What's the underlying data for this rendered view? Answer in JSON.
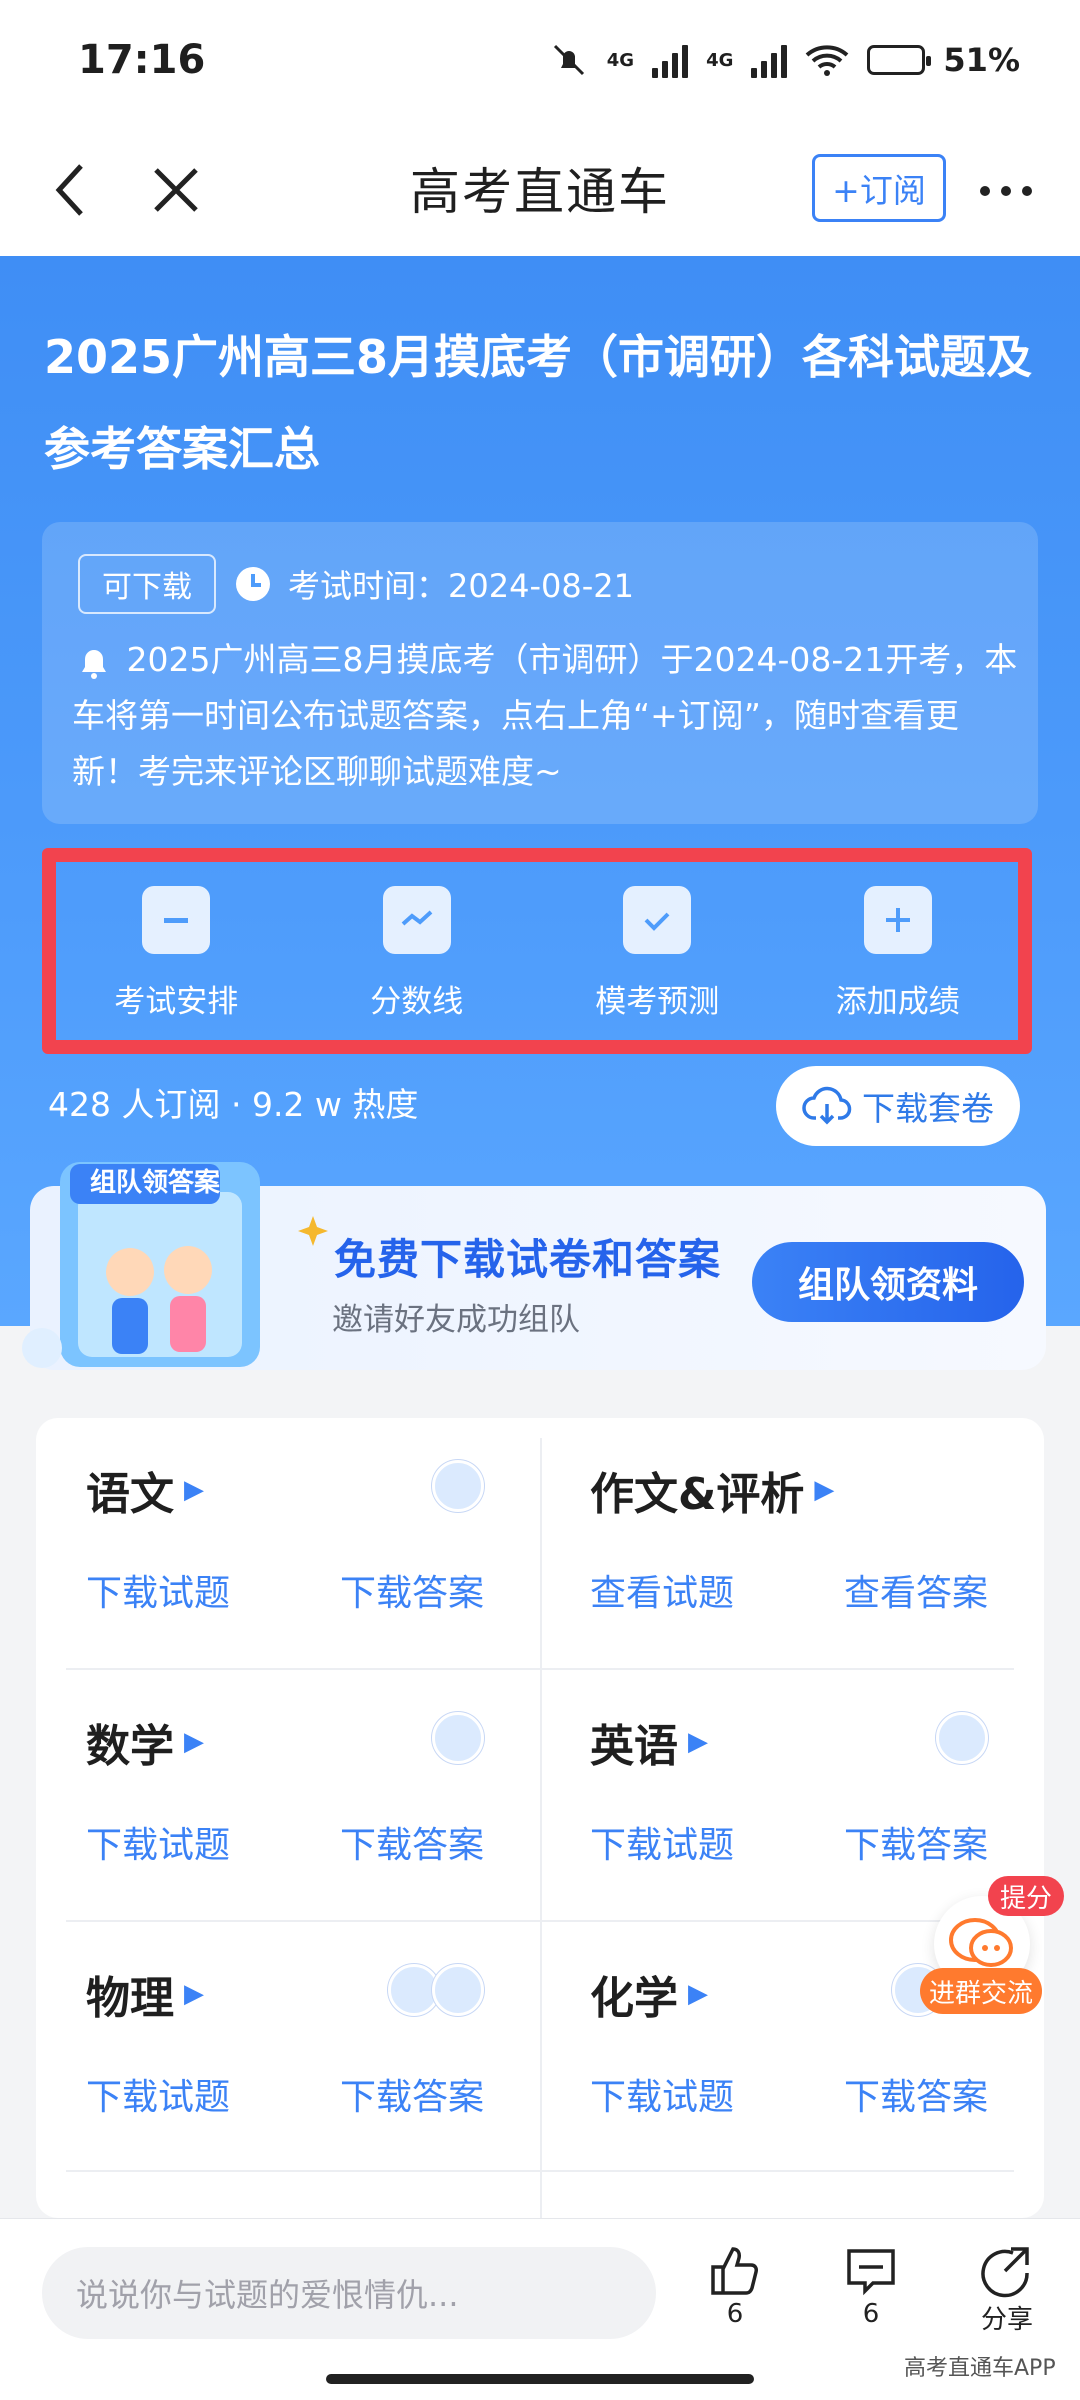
{
  "status": {
    "time": "17:16",
    "net1": "4G",
    "net2": "4G",
    "battery": "51%",
    "battery_level": 0.51
  },
  "nav": {
    "title": "高考直通车",
    "subscribe": "+订阅"
  },
  "hero": {
    "title": "2025广州高三8月摸底考（市调研）各科试题及参考答案汇总",
    "tag": "可下载",
    "exam_time_label": "考试时间：2024-08-21",
    "notice": "2025广州高三8月摸底考（市调研）于2024-08-21开考，本车将第一时间公布试题答案，点右上角“+订阅”，随时查看更新！考完来评论区聊聊试题难度~",
    "actions": [
      {
        "label": "考试安排",
        "icon": "minus-calendar-icon"
      },
      {
        "label": "分数线",
        "icon": "line-chart-icon"
      },
      {
        "label": "模考预测",
        "icon": "check-clipboard-icon"
      },
      {
        "label": "添加成绩",
        "icon": "plus-icon"
      }
    ],
    "stats": "428 人订阅 · 9.2 w 热度",
    "download_set": "下载套卷"
  },
  "banner": {
    "illustration_text": "组队领答案",
    "title": "免费下载试卷和答案",
    "subtitle": "邀请好友成功组队",
    "cta": "组队领资料"
  },
  "subjects": [
    {
      "name": "语文",
      "link1": "下载试题",
      "link2": "下载答案"
    },
    {
      "name": "作文&评析",
      "link1": "查看试题",
      "link2": "查看答案"
    },
    {
      "name": "数学",
      "link1": "下载试题",
      "link2": "下载答案"
    },
    {
      "name": "英语",
      "link1": "下载试题",
      "link2": "下载答案"
    },
    {
      "name": "物理",
      "link1": "下载试题",
      "link2": "下载答案"
    },
    {
      "name": "化学",
      "link1": "下载试题",
      "link2": "下载答案"
    }
  ],
  "float": {
    "badge": "提分",
    "label": "进群交流"
  },
  "bottom": {
    "comment_placeholder": "说说你与试题的爱恨情仇...",
    "likes": "6",
    "comments": "6",
    "share": "分享"
  },
  "watermark": "高考直通车APP",
  "colors": {
    "primary": "#3b82f6",
    "hero": "#4e9cfb",
    "highlight_border": "#f2434e"
  }
}
